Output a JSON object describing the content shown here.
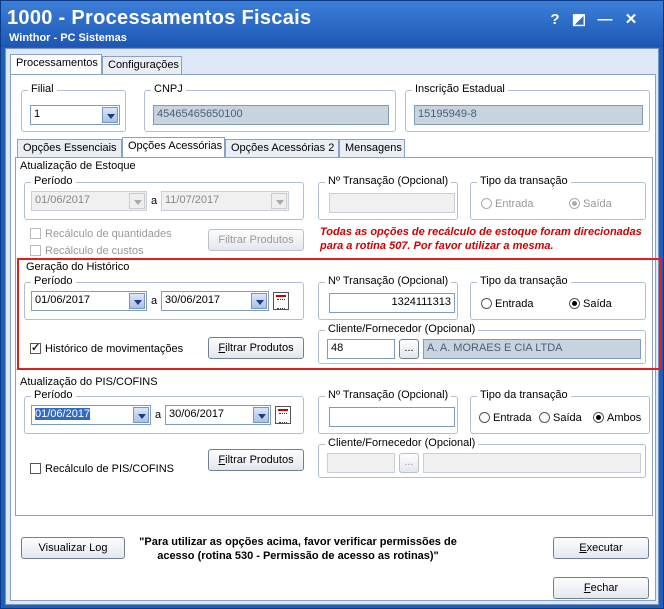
{
  "window": {
    "title": "1000 - Processamentos Fiscais",
    "subtitle": "Winthor - PC Sistemas",
    "buttons": [
      "?",
      "◩",
      "—",
      "✕"
    ]
  },
  "main_tabs": [
    "Processamentos",
    "Configurações"
  ],
  "filial": {
    "label": "Filial",
    "value": "1"
  },
  "cnpj": {
    "label": "CNPJ",
    "value": "45465465650100"
  },
  "inscricao": {
    "label": "Inscrição Estadual",
    "value": "15195949-8"
  },
  "sub_tabs": [
    "Opções Essenciais",
    "Opções Acessórias",
    "Opções Acessórias 2",
    "Mensagens"
  ],
  "estoque": {
    "title": "Atualização de Estoque",
    "periodo_label": "Período",
    "date_from": "01/06/2017",
    "a": "a",
    "date_to": "11/07/2017",
    "transacao_label": "Nº Transação (Opcional)",
    "transacao_value": "",
    "tipo_label": "Tipo da transação",
    "radio_entrada": "Entrada",
    "radio_saida": "Saída",
    "check_quantidades": "Recálculo de quantidades",
    "check_custos": "Recálculo de custos",
    "filtrar": "Filtrar Produtos",
    "note": "Todas as opções de recálculo de estoque foram direcionadas para a rotina 507. Por favor utilizar a mesma."
  },
  "historico": {
    "title": "Geração do Histórico",
    "periodo_label": "Período",
    "date_from": "01/06/2017",
    "a": "a",
    "date_to": "30/06/2017",
    "transacao_label": "Nº Transação (Opcional)",
    "transacao_value": "1324111313",
    "tipo_label": "Tipo da transação",
    "radio_entrada": "Entrada",
    "radio_saida": "Saída",
    "check_historico": "Histórico de movimentações",
    "filtrar": "Filtrar Produtos",
    "cliente_label": "Cliente/Fornecedor (Opcional)",
    "cliente_code": "48",
    "cliente_btn": "...",
    "cliente_name": "A. A. MORAES E CIA LTDA"
  },
  "pis": {
    "title": "Atualização do PIS/COFINS",
    "periodo_label": "Período",
    "date_from": "01/06/2017",
    "a": "a",
    "date_to": "30/06/2017",
    "transacao_label": "Nº Transação (Opcional)",
    "transacao_value": "",
    "tipo_label": "Tipo da transação",
    "radio_entrada": "Entrada",
    "radio_saida": "Saída",
    "radio_ambos": "Ambos",
    "check_recalculo": "Recálculo de PIS/COFINS",
    "filtrar": "Filtrar Produtos",
    "cliente_label": "Cliente/Fornecedor (Opcional)",
    "cliente_code": "",
    "cliente_btn": "...",
    "cliente_name": ""
  },
  "footer": {
    "visualizar_log": "Visualizar Log",
    "message": "\"Para utilizar as opções acima, favor verificar permissões de acesso (rotina 530 - Permissão de acesso as rotinas)\"",
    "executar": "Executar",
    "fechar": "Fechar"
  },
  "colors": {
    "title_bar": "#1c57b3",
    "highlight": "#e02020",
    "note": "#d00000"
  }
}
